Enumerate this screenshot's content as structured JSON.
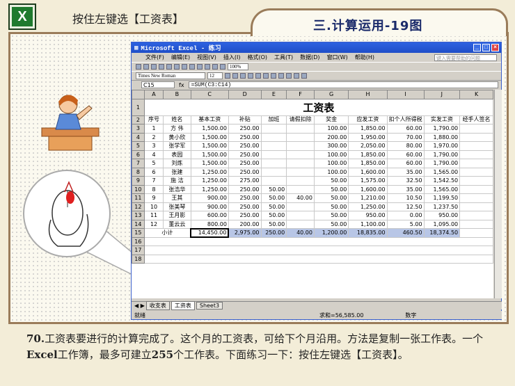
{
  "header": {
    "title": "按住左键选【工资表】",
    "logo": "X"
  },
  "section_title": "三.计算运用-19图",
  "excel": {
    "window_title": "Microsoft Excel - 练习",
    "menu": [
      "文件(F)",
      "编辑(E)",
      "视图(V)",
      "插入(I)",
      "格式(O)",
      "工具(T)",
      "数据(D)",
      "窗口(W)",
      "帮助(H)"
    ],
    "help_placeholder": "键入需要帮助的问题",
    "font_name": "Times New Roman",
    "font_size": "12",
    "zoom": "100%",
    "name_box": "C15",
    "formula": "=SUM(C3:C14)",
    "col_headers": [
      "A",
      "B",
      "C",
      "D",
      "E",
      "F",
      "G",
      "H",
      "I",
      "J",
      "K"
    ],
    "sheet_title": "工资表",
    "table_headers": [
      "序号",
      "姓名",
      "基本工资",
      "补贴",
      "加班",
      "请假扣除",
      "奖金",
      "应发工资",
      "扣个人所得税",
      "实发工资",
      "经手人签名"
    ],
    "rows": [
      [
        "1",
        "方 伟",
        "1,500.00",
        "250.00",
        "",
        "",
        "100.00",
        "1,850.00",
        "60.00",
        "1,790.00",
        ""
      ],
      [
        "2",
        "黄小欣",
        "1,500.00",
        "250.00",
        "",
        "",
        "200.00",
        "1,950.00",
        "70.00",
        "1,880.00",
        ""
      ],
      [
        "3",
        "张学军",
        "1,500.00",
        "250.00",
        "",
        "",
        "300.00",
        "2,050.00",
        "80.00",
        "1,970.00",
        ""
      ],
      [
        "4",
        "表园",
        "1,500.00",
        "250.00",
        "",
        "",
        "100.00",
        "1,850.00",
        "60.00",
        "1,790.00",
        ""
      ],
      [
        "5",
        "刘炼",
        "1,500.00",
        "250.00",
        "",
        "",
        "100.00",
        "1,850.00",
        "60.00",
        "1,790.00",
        ""
      ],
      [
        "6",
        "张建",
        "1,250.00",
        "250.00",
        "",
        "",
        "100.00",
        "1,600.00",
        "35.00",
        "1,565.00",
        ""
      ],
      [
        "7",
        "施 洁",
        "1,250.00",
        "275.00",
        "",
        "",
        "50.00",
        "1,575.00",
        "32.50",
        "1,542.50",
        ""
      ],
      [
        "8",
        "张浩华",
        "1,250.00",
        "250.00",
        "50.00",
        "",
        "50.00",
        "1,600.00",
        "35.00",
        "1,565.00",
        ""
      ],
      [
        "9",
        "王其",
        "900.00",
        "250.00",
        "50.00",
        "40.00",
        "50.00",
        "1,210.00",
        "10.50",
        "1,199.50",
        ""
      ],
      [
        "10",
        "张美琴",
        "900.00",
        "250.00",
        "50.00",
        "",
        "50.00",
        "1,250.00",
        "12.50",
        "1,237.50",
        ""
      ],
      [
        "11",
        "王月影",
        "600.00",
        "250.00",
        "50.00",
        "",
        "50.00",
        "950.00",
        "0.00",
        "950.00",
        ""
      ],
      [
        "12",
        "董云云",
        "800.00",
        "200.00",
        "50.00",
        "",
        "50.00",
        "1,100.00",
        "5.00",
        "1,095.00",
        ""
      ]
    ],
    "total_label": "小计",
    "totals": [
      "14,450.00",
      "2,975.00",
      "250.00",
      "40.00",
      "1,200.00",
      "18,835.00",
      "460.50",
      "18,374.50"
    ],
    "row_numbers": [
      "1",
      "2",
      "3",
      "4",
      "5",
      "6",
      "7",
      "8",
      "9",
      "10",
      "11",
      "12",
      "13",
      "14",
      "15",
      "16",
      "17",
      "18"
    ],
    "sheet_tabs": [
      "收支表",
      "工资表",
      "Sheet3"
    ],
    "status_ready": "就绪",
    "status_sum": "求和=56,585.00",
    "status_mode": "数字"
  },
  "caption": {
    "num": "70.",
    "text1": "工资表要进行的计算完成了。这个月的工资表，可给下个月沿用。方法是复制一张工作表。一个",
    "excel_word": "Excel",
    "text2": "工作簿，最多可建立",
    "count": "255",
    "text3": "个工作表。下面练习一下：按住左键选【工资表】。"
  }
}
